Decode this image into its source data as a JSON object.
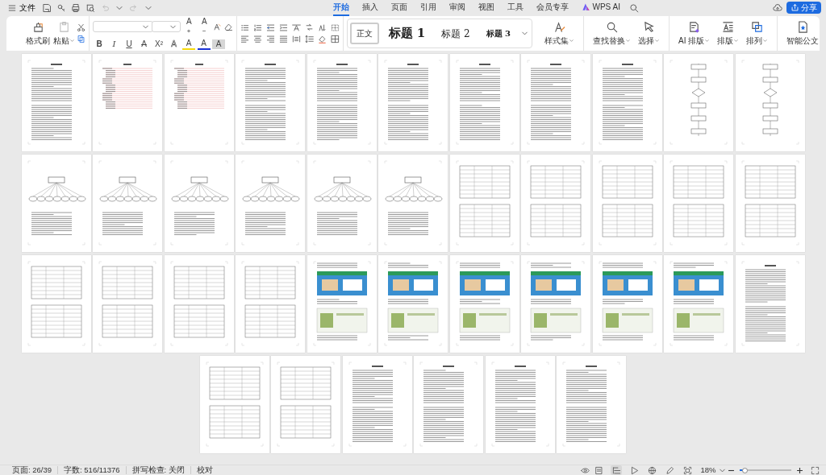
{
  "menu": {
    "label": "文件"
  },
  "tabs": [
    {
      "label": "开始",
      "selected": true
    },
    {
      "label": "插入",
      "selected": false
    },
    {
      "label": "页面",
      "selected": false
    },
    {
      "label": "引用",
      "selected": false
    },
    {
      "label": "审阅",
      "selected": false
    },
    {
      "label": "视图",
      "selected": false
    },
    {
      "label": "工具",
      "selected": false
    },
    {
      "label": "会员专享",
      "selected": false
    }
  ],
  "ai_tab": {
    "label": "WPS AI"
  },
  "share_button": {
    "label": "分享"
  },
  "clipboard": {
    "format_painter": "格式刷",
    "paste": "粘贴"
  },
  "size_buttons": [
    {
      "glyph": "A",
      "kind": "grow"
    },
    {
      "glyph": "A",
      "kind": "shrink"
    }
  ],
  "format_buttons": [
    {
      "glyph": "B",
      "kind": "bold"
    },
    {
      "glyph": "I",
      "kind": "italic"
    },
    {
      "glyph": "U",
      "kind": "underline"
    },
    {
      "glyph": "A",
      "kind": "strike"
    },
    {
      "glyph": "X²",
      "kind": "superscript"
    },
    {
      "glyph": "A",
      "kind": "effect"
    },
    {
      "glyph": "A",
      "kind": "highlight"
    },
    {
      "glyph": "A",
      "kind": "color"
    },
    {
      "glyph": "A",
      "kind": "shading"
    }
  ],
  "styles": [
    {
      "label": "正文",
      "kind": "body",
      "selected": true
    },
    {
      "label": "标题 1",
      "kind": "h1",
      "selected": false
    },
    {
      "label": "标题 2",
      "kind": "h2",
      "selected": false
    },
    {
      "label": "标题 3",
      "kind": "h3",
      "selected": false
    }
  ],
  "tools": [
    {
      "label": "样式集",
      "kind": "styleset"
    },
    {
      "label": "查找替换",
      "kind": "find"
    },
    {
      "label": "选择",
      "kind": "select"
    },
    {
      "label": "AI 排版",
      "kind": "ai"
    },
    {
      "label": "排版",
      "kind": "layout"
    },
    {
      "label": "排列",
      "kind": "arrange"
    },
    {
      "label": "智能公文",
      "kind": "doc"
    }
  ],
  "pages": [
    {
      "kind": "text"
    },
    {
      "kind": "toc"
    },
    {
      "kind": "toc"
    },
    {
      "kind": "text"
    },
    {
      "kind": "text"
    },
    {
      "kind": "text"
    },
    {
      "kind": "text"
    },
    {
      "kind": "text"
    },
    {
      "kind": "text"
    },
    {
      "kind": "flowchart"
    },
    {
      "kind": "flowchart"
    },
    {
      "kind": "diagram"
    },
    {
      "kind": "diagram"
    },
    {
      "kind": "diagram"
    },
    {
      "kind": "diagram"
    },
    {
      "kind": "diagram"
    },
    {
      "kind": "diagram"
    },
    {
      "kind": "table"
    },
    {
      "kind": "table"
    },
    {
      "kind": "table"
    },
    {
      "kind": "table"
    },
    {
      "kind": "table"
    },
    {
      "kind": "table"
    },
    {
      "kind": "table"
    },
    {
      "kind": "table"
    },
    {
      "kind": "table"
    },
    {
      "kind": "screenshot"
    },
    {
      "kind": "screenshot"
    },
    {
      "kind": "screenshot"
    },
    {
      "kind": "screenshot"
    },
    {
      "kind": "screenshot"
    },
    {
      "kind": "screenshot"
    },
    {
      "kind": "text"
    },
    {
      "kind": "table"
    },
    {
      "kind": "table"
    },
    {
      "kind": "text"
    },
    {
      "kind": "text"
    },
    {
      "kind": "text"
    },
    {
      "kind": "text"
    }
  ],
  "status_bar": {
    "page": "页面: 26/39",
    "words": "字数: 516/11376",
    "spell": "拼写检查: 关闭",
    "proof": "校对",
    "zoom": "18%",
    "zoom_slider": {
      "level": 0.1
    },
    "view_modes": [
      {
        "selected": false
      },
      {
        "selected": true
      },
      {
        "selected": false
      },
      {
        "selected": false
      },
      {
        "selected": false
      },
      {
        "selected": false
      }
    ]
  }
}
